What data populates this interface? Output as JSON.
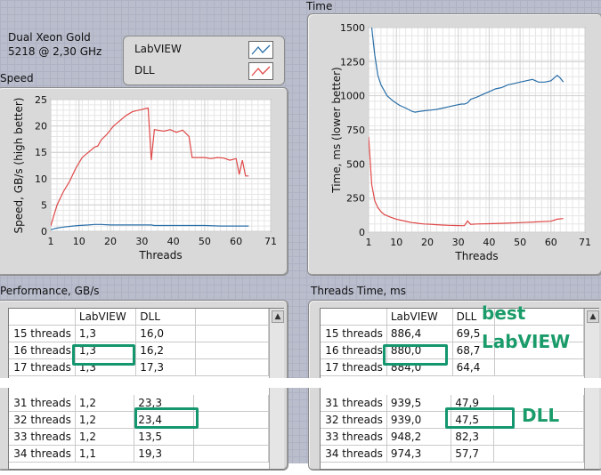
{
  "cpu": {
    "line1": "Dual Xeon Gold",
    "line2": "5218 @ 2,30 GHz"
  },
  "legend": {
    "items": [
      {
        "label": "LabVIEW",
        "color": "#2a6fa8"
      },
      {
        "label": "DLL",
        "color": "#e04848"
      }
    ]
  },
  "speed_chart": {
    "title": "Speed",
    "ylabel": "Speed, GB/s (high better)",
    "xlabel": "Threads",
    "yticks": [
      "0",
      "5",
      "10",
      "15",
      "20",
      "25"
    ],
    "xticks": [
      "1",
      "10",
      "20",
      "30",
      "40",
      "50",
      "60",
      "71"
    ]
  },
  "time_chart": {
    "title": "Time",
    "ylabel": "Time, ms (lower better)",
    "xlabel": "Threads",
    "yticks": [
      "0",
      "250",
      "500",
      "750",
      "1000",
      "1250",
      "1500"
    ],
    "xticks": [
      "1",
      "10",
      "20",
      "30",
      "40",
      "50",
      "60",
      "71"
    ]
  },
  "chart_data": [
    {
      "type": "line",
      "title": "Speed",
      "xlabel": "Threads",
      "ylabel": "Speed, GB/s (high better)",
      "xlim": [
        1,
        71
      ],
      "ylim": [
        0,
        25
      ],
      "series": [
        {
          "name": "LabVIEW",
          "color": "#2a6fa8",
          "x": [
            1,
            3,
            5,
            8,
            10,
            13,
            15,
            16,
            17,
            20,
            25,
            30,
            31,
            32,
            33,
            34,
            40,
            45,
            50,
            55,
            60,
            64
          ],
          "y": [
            0.3,
            0.6,
            0.8,
            1.0,
            1.1,
            1.2,
            1.3,
            1.3,
            1.3,
            1.2,
            1.2,
            1.2,
            1.2,
            1.2,
            1.2,
            1.1,
            1.1,
            1.1,
            1.1,
            1.0,
            1.0,
            1.0
          ]
        },
        {
          "name": "DLL",
          "color": "#e04848",
          "x": [
            1,
            2,
            3,
            5,
            7,
            9,
            11,
            13,
            15,
            16,
            17,
            19,
            21,
            23,
            25,
            27,
            29,
            30,
            31,
            32,
            33,
            34,
            35,
            37,
            39,
            41,
            43,
            45,
            46,
            48,
            50,
            52,
            54,
            56,
            58,
            60,
            61,
            62,
            63,
            64
          ],
          "y": [
            1.0,
            3.0,
            5.0,
            7.5,
            9.5,
            12.0,
            14.0,
            15.0,
            16.0,
            16.2,
            17.3,
            18.5,
            20.0,
            21.0,
            22.0,
            22.7,
            23.0,
            23.1,
            23.3,
            23.4,
            13.5,
            19.3,
            19.2,
            19.0,
            19.3,
            18.8,
            19.2,
            18.0,
            14.0,
            14.0,
            14.0,
            13.8,
            14.0,
            13.9,
            13.5,
            13.8,
            10.8,
            13.5,
            10.5,
            10.5
          ]
        }
      ]
    },
    {
      "type": "line",
      "title": "Time",
      "xlabel": "Threads",
      "ylabel": "Time, ms (lower better)",
      "xlim": [
        1,
        71
      ],
      "ylim": [
        0,
        1500
      ],
      "series": [
        {
          "name": "LabVIEW",
          "color": "#2a6fa8",
          "x": [
            1,
            2,
            3,
            4,
            5,
            7,
            9,
            11,
            13,
            15,
            16,
            17,
            19,
            21,
            23,
            25,
            27,
            29,
            31,
            32,
            33,
            34,
            36,
            38,
            40,
            42,
            44,
            46,
            48,
            50,
            52,
            54,
            56,
            58,
            60,
            62,
            63,
            64
          ],
          "y": [
            1600,
            1500,
            1300,
            1150,
            1080,
            1000,
            960,
            930,
            910,
            886,
            880,
            884,
            890,
            895,
            900,
            910,
            920,
            930,
            939,
            939,
            948,
            974,
            990,
            1010,
            1030,
            1050,
            1060,
            1080,
            1090,
            1100,
            1110,
            1120,
            1100,
            1100,
            1110,
            1150,
            1130,
            1100
          ]
        },
        {
          "name": "DLL",
          "color": "#e04848",
          "x": [
            1,
            2,
            3,
            4,
            5,
            6,
            8,
            10,
            12,
            14,
            15,
            16,
            17,
            19,
            21,
            23,
            25,
            27,
            29,
            31,
            32,
            33,
            34,
            36,
            40,
            45,
            50,
            55,
            60,
            62,
            64
          ],
          "y": [
            700,
            350,
            230,
            180,
            150,
            130,
            110,
            95,
            85,
            75,
            69.5,
            68.7,
            64.4,
            60,
            58,
            55,
            52,
            50,
            49,
            47.9,
            47.5,
            82.3,
            57.7,
            60,
            62,
            65,
            70,
            75,
            80,
            95,
            100
          ]
        }
      ]
    }
  ],
  "perf_table": {
    "title": "Performance, GB/s",
    "headers": [
      "",
      "LabVIEW",
      "DLL",
      ""
    ],
    "rows_top": [
      [
        "15 threads",
        "1,3",
        "16,0"
      ],
      [
        "16 threads",
        "1,3",
        "16,2"
      ],
      [
        "17 threads",
        "1,3",
        "17,3"
      ]
    ],
    "rows_bottom": [
      [
        "31 threads",
        "1,2",
        "23,3"
      ],
      [
        "32 threads",
        "1,2",
        "23,4"
      ],
      [
        "33 threads",
        "1,2",
        "13,5"
      ],
      [
        "34 threads",
        "1,1",
        "19,3"
      ]
    ]
  },
  "time_table": {
    "title": "Threads Time, ms",
    "headers": [
      "",
      "LabVIEW",
      "DLL",
      ""
    ],
    "rows_top": [
      [
        "15 threads",
        "886,4",
        "69,5"
      ],
      [
        "16 threads",
        "880,0",
        "68,7"
      ],
      [
        "17 threads",
        "884,0",
        "64,4"
      ]
    ],
    "rows_bottom": [
      [
        "31 threads",
        "939,5",
        "47,9"
      ],
      [
        "32 threads",
        "939,0",
        "47,5"
      ],
      [
        "33 threads",
        "948,2",
        "82,3"
      ],
      [
        "34 threads",
        "974,3",
        "57,7"
      ]
    ]
  },
  "annotations": {
    "best": "best",
    "labview": "LabVIEW",
    "dll": "DLL"
  }
}
